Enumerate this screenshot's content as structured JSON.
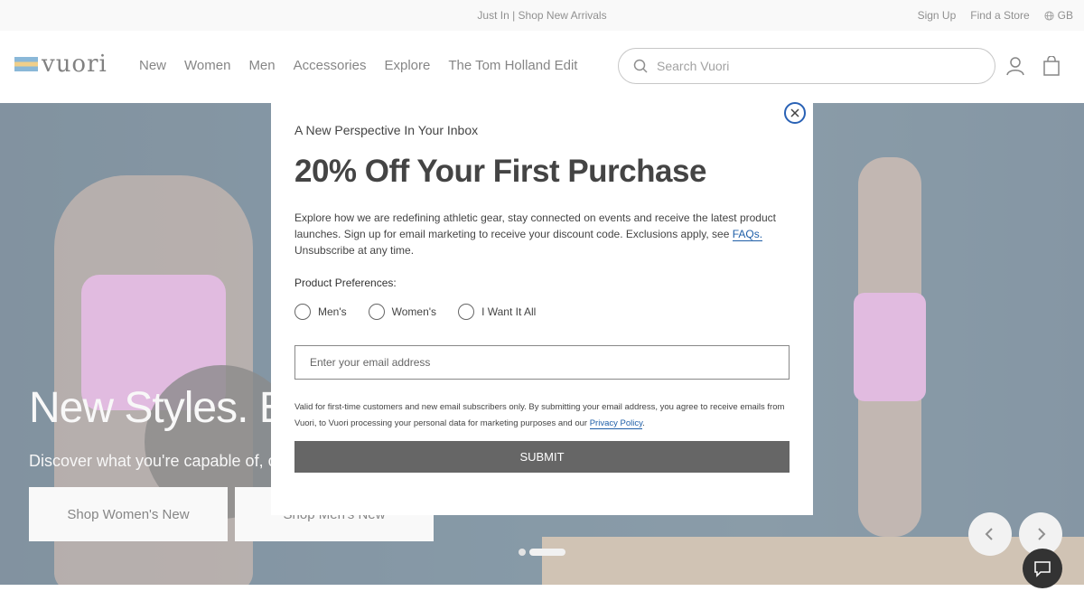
{
  "announcement": {
    "promo_text": "Just In | Shop New Arrivals",
    "sign_up": "Sign Up",
    "find_store": "Find a Store",
    "region": "GB"
  },
  "header": {
    "logo_text": "vuori",
    "nav": [
      "New",
      "Women",
      "Men",
      "Accessories",
      "Explore",
      "The Tom Holland Edit"
    ],
    "search_placeholder": "Search Vuori",
    "icons": [
      "account-icon",
      "cart-icon"
    ]
  },
  "hero": {
    "title": "New Styles. Endless Possibilities",
    "subtitle": "Discover what you're capable of, on and off the mat.",
    "buttons": [
      "Shop Women's New",
      "Shop Men's New"
    ],
    "slides_total": 2,
    "active_slide": 2
  },
  "modal": {
    "eyebrow": "A New Perspective In Your Inbox",
    "headline": "20% Off Your First Purchase",
    "body_prefix": "Explore how we are redefining athletic gear, stay connected on events and receive the latest product launches. Sign up for email marketing to receive your discount code. Exclusions apply, see ",
    "body_link": "FAQs.",
    "body_suffix": " Unsubscribe at any time.",
    "preferences_label": "Product Preferences:",
    "options": [
      "Men's",
      "Women's",
      "I Want It All"
    ],
    "email_placeholder": "Enter your email address",
    "legal_prefix": "Valid for first-time customers and new email subscribers only. By submitting your email address, you agree to receive emails from Vuori, to Vuori processing your personal data for marketing purposes and our ",
    "legal_link": "Privacy Policy",
    "legal_suffix": ".",
    "submit_label": "SUBMIT"
  },
  "colors": {
    "link": "#1f5fa8",
    "close_ring": "#2a62b5",
    "submit_bg": "#666666"
  }
}
